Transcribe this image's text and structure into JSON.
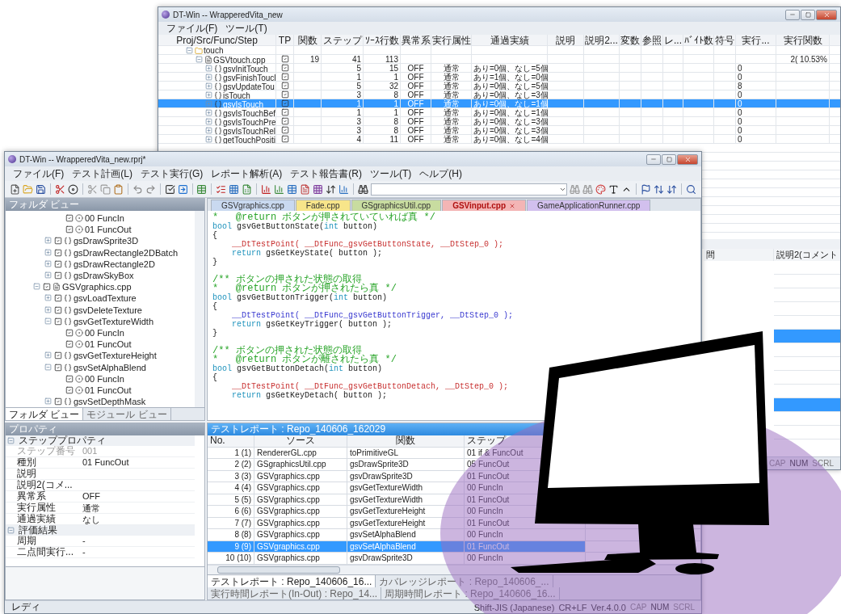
{
  "back_window": {
    "title": "DT-Win -- WrapperedVita_new",
    "menu": [
      "ファイル(F)",
      "ツール(T)"
    ],
    "columns": [
      "Proj/Src/Func/Step",
      "TP",
      "関数",
      "ステップ",
      "ｿｰｽ行数",
      "異常系",
      "実行属性",
      "通過実績",
      "説明",
      "説明2...",
      "変数",
      "参照",
      "レ...",
      "ﾊﾞｲﾄ数",
      "符号",
      "実行...",
      "実行関数"
    ],
    "rows": [
      {
        "label": "touch",
        "kind": "folder",
        "expanded": true,
        "selected": false,
        "children": [
          {
            "label": "GSVtouch.cpp",
            "kind": "file",
            "expanded": true,
            "tp": true,
            "selected": false,
            "cells": [
              "19",
              "41",
              "113",
              null,
              null,
              null,
              null,
              null,
              null,
              null,
              null,
              null,
              null,
              null,
              "2( 10.53%"
            ],
            "children": [
              {
                "label": "gsvInitTouch",
                "kind": "func",
                "expanded": false,
                "tp": true,
                "selected": false,
                "cells": [
                  null,
                  "5",
                  "15",
                  "OFF",
                  "通常",
                  "あり=0個、なし=5個",
                  null,
                  null,
                  null,
                  null,
                  null,
                  null,
                  null,
                  "0",
                  null
                ]
              },
              {
                "label": "gsvFinishToucl",
                "kind": "func",
                "expanded": false,
                "tp": true,
                "selected": false,
                "cells": [
                  null,
                  "1",
                  "1",
                  "OFF",
                  "通常",
                  "あり=1個、なし=0個",
                  null,
                  null,
                  null,
                  null,
                  null,
                  null,
                  null,
                  "0",
                  null
                ]
              },
              {
                "label": "gsvUpdateTou",
                "kind": "func",
                "expanded": false,
                "tp": true,
                "selected": false,
                "cells": [
                  null,
                  "5",
                  "32",
                  "OFF",
                  "通常",
                  "あり=0個、なし=5個",
                  null,
                  null,
                  null,
                  null,
                  null,
                  null,
                  null,
                  "8",
                  null
                ]
              },
              {
                "label": "isTouch",
                "kind": "func",
                "expanded": false,
                "tp": true,
                "selected": false,
                "cells": [
                  null,
                  "3",
                  "8",
                  "OFF",
                  "通常",
                  "あり=0個、なし=3個",
                  null,
                  null,
                  null,
                  null,
                  null,
                  null,
                  null,
                  "0",
                  null
                ]
              },
              {
                "label": "gsvIsTouch",
                "kind": "func",
                "expanded": false,
                "tp": true,
                "selected": true,
                "cells": [
                  null,
                  "1",
                  "1",
                  "OFF",
                  "通常",
                  "あり=0個、なし=1個",
                  null,
                  null,
                  null,
                  null,
                  null,
                  null,
                  null,
                  "0",
                  null
                ]
              },
              {
                "label": "gsvIsTouchBef",
                "kind": "func",
                "expanded": false,
                "tp": true,
                "selected": false,
                "cells": [
                  null,
                  "1",
                  "1",
                  "OFF",
                  "通常",
                  "あり=0個、なし=1個",
                  null,
                  null,
                  null,
                  null,
                  null,
                  null,
                  null,
                  "0",
                  null
                ]
              },
              {
                "label": "gsvIsTouchPre",
                "kind": "func",
                "expanded": false,
                "tp": true,
                "selected": false,
                "cells": [
                  null,
                  "3",
                  "8",
                  "OFF",
                  "通常",
                  "あり=0個、なし=3個",
                  null,
                  null,
                  null,
                  null,
                  null,
                  null,
                  null,
                  "0",
                  null
                ]
              },
              {
                "label": "gsvIsTouchRel",
                "kind": "func",
                "expanded": false,
                "tp": true,
                "selected": false,
                "cells": [
                  null,
                  "3",
                  "8",
                  "OFF",
                  "通常",
                  "あり=0個、なし=3個",
                  null,
                  null,
                  null,
                  null,
                  null,
                  null,
                  null,
                  "0",
                  null
                ]
              },
              {
                "label": "getTouchPositi",
                "kind": "func",
                "expanded": false,
                "tp": true,
                "selected": false,
                "cells": [
                  null,
                  "4",
                  "11",
                  "OFF",
                  "通常",
                  "あり=0個、なし=4個",
                  null,
                  null,
                  null,
                  null,
                  null,
                  null,
                  null,
                  "0",
                  null
                ]
              }
            ]
          }
        ]
      }
    ],
    "lower_columns": [
      "間",
      "説明2(コメント"
    ],
    "lower_rows": [
      {
        "selected": false
      },
      {
        "selected": false
      },
      {
        "selected": false
      },
      {
        "selected": false
      },
      {
        "selected": false
      },
      {
        "selected": true
      },
      {
        "selected": false
      },
      {
        "selected": false
      },
      {
        "selected": false
      },
      {
        "selected": false
      },
      {
        "selected": true
      },
      {
        "selected": false
      },
      {
        "selected": false
      }
    ],
    "indicators": [
      {
        "label": "CAP",
        "on": false
      },
      {
        "label": "NUM",
        "on": true
      },
      {
        "label": "SCRL",
        "on": false
      }
    ]
  },
  "front_window": {
    "title": "DT-Win -- WrapperedVita_new.rprj*",
    "menu": [
      "ファイル(F)",
      "テスト計画(L)",
      "テスト実行(G)",
      "レポート解析(A)",
      "テスト報告書(R)",
      "ツール(T)",
      "ヘルプ(H)"
    ],
    "folder_view": {
      "title": "フォルダ ビュー",
      "tree": [
        {
          "children": [
            {
              "children": [
                {
                  "label": "00 FuncIn",
                  "kind": "step",
                  "checked": true
                },
                {
                  "label": "01 FuncOut",
                  "kind": "step",
                  "checked": true
                }
              ]
            },
            {
              "label": "gsDrawSprite3D",
              "kind": "func",
              "checked": true,
              "expanded": false
            },
            {
              "label": "gsDrawRectangle2DBatch",
              "kind": "func",
              "checked": true,
              "expanded": false
            },
            {
              "label": "gsDrawRectangle2D",
              "kind": "func",
              "checked": true,
              "expanded": false
            },
            {
              "label": "gsDrawSkyBox",
              "kind": "func",
              "checked": true,
              "expanded": false
            }
          ]
        },
        {
          "label": "GSVgraphics.cpp",
          "kind": "file",
          "checked": true,
          "expanded": true,
          "children": [
            {
              "label": "gsvLoadTexture",
              "kind": "func",
              "checked": true,
              "expanded": false
            },
            {
              "label": "gsvDeleteTexture",
              "kind": "func",
              "checked": true,
              "expanded": false
            },
            {
              "label": "gsvGetTextureWidth",
              "kind": "func",
              "checked": true,
              "expanded": true,
              "children": [
                {
                  "label": "00 FuncIn",
                  "kind": "step",
                  "checked": true
                },
                {
                  "label": "01 FuncOut",
                  "kind": "step",
                  "checked": true
                }
              ]
            },
            {
              "label": "gsvGetTextureHeight",
              "kind": "func",
              "checked": true,
              "expanded": false
            },
            {
              "label": "gsvSetAlphaBlend",
              "kind": "func",
              "checked": true,
              "expanded": true,
              "children": [
                {
                  "label": "00 FuncIn",
                  "kind": "step",
                  "checked": true
                },
                {
                  "label": "01 FuncOut",
                  "kind": "step",
                  "checked": true
                }
              ]
            },
            {
              "label": "gsvSetDepthMask",
              "kind": "func",
              "checked": true,
              "expanded": false
            }
          ]
        }
      ],
      "tabs": [
        {
          "label": "フォルダ ビュー",
          "selected": true
        },
        {
          "label": "モジュール ビュー",
          "selected": false
        }
      ]
    },
    "properties": {
      "title": "プロパティ",
      "sections": [
        {
          "label": "ステッププロパティ",
          "expanded": true,
          "rows": [
            {
              "name": "ステップ番号",
              "value": "001",
              "disabled": true
            },
            {
              "name": "種別",
              "value": "01 FuncOut",
              "disabled": false
            },
            {
              "name": "説明",
              "disabled": false
            },
            {
              "name": "説明2(コメ...",
              "disabled": false
            },
            {
              "name": "異常系",
              "value": "OFF",
              "disabled": false
            },
            {
              "name": "実行属性",
              "value": "通常",
              "disabled": false
            },
            {
              "name": "通過実績",
              "value": "なし",
              "disabled": false
            }
          ]
        },
        {
          "label": "評価結果",
          "expanded": true,
          "rows": [
            {
              "name": "周期",
              "value": "-",
              "disabled": false
            },
            {
              "name": "二点間実行...",
              "value": "-",
              "disabled": false
            }
          ]
        }
      ]
    },
    "editor": {
      "tabs": [
        {
          "label": "GSVgraphics.cpp",
          "color": "#c9d9f0",
          "selected": false
        },
        {
          "label": "Fade.cpp",
          "color": "#f7e58a",
          "selected": false
        },
        {
          "label": "GSgraphicsUtil.cpp",
          "color": "#c8dca0",
          "selected": false
        },
        {
          "label": "GSVinput.cpp",
          "color": "#f3b5b5",
          "selected": true
        },
        {
          "label": "GameApplicationRunner.cpp",
          "color": "#d2c0ee",
          "selected": false
        }
      ],
      "lines": [
        [
          {
            "text": "*   @return ボタンが押されていていれば真 */",
            "kind": "comment"
          }
        ],
        [
          {
            "text": "bool",
            "kind": "keyword"
          },
          {
            "text": " gsvGetButtonState(",
            "kind": "plain"
          },
          {
            "text": "int",
            "kind": "keyword"
          },
          {
            "text": " button)",
            "kind": "plain"
          }
        ],
        [
          {
            "text": "{",
            "kind": "plain"
          }
        ],
        [
          {
            "text": "    __DtTestPoint( __DtFunc_gsvGetButtonState, __DtStep_0 );",
            "kind": "probe_hit"
          }
        ],
        [
          {
            "text": "    return",
            "kind": "keyword"
          },
          {
            "text": " gsGetKeyState( button );",
            "kind": "plain"
          }
        ],
        [
          {
            "text": "}",
            "kind": "plain"
          }
        ],
        [
          {
            "text": "/** ボタンの押された状態の取得",
            "kind": "doc_comment"
          }
        ],
        [
          {
            "text": "*   @return ボタンが押されたら真 */",
            "kind": "comment"
          }
        ],
        [
          {
            "text": "bool",
            "kind": "keyword"
          },
          {
            "text": " gsvGetButtonTrigger(",
            "kind": "plain"
          },
          {
            "text": "int",
            "kind": "keyword"
          },
          {
            "text": " button)",
            "kind": "plain"
          }
        ],
        [
          {
            "text": "{",
            "kind": "plain"
          }
        ],
        [
          {
            "text": "    __DtTestPoint( __DtFunc_gsvGetButtonTrigger, __DtStep_0 );",
            "kind": "probe"
          }
        ],
        [
          {
            "text": "    return",
            "kind": "keyword"
          },
          {
            "text": " gsGetKeyTrigger( button );",
            "kind": "plain"
          }
        ],
        [
          {
            "text": "}",
            "kind": "plain"
          }
        ],
        [
          {
            "text": "/** ボタンの押された状態の取得",
            "kind": "doc_comment"
          }
        ],
        [
          {
            "text": "*   @return ボタンが離されたら真 */",
            "kind": "comment"
          }
        ],
        [
          {
            "text": "bool",
            "kind": "keyword"
          },
          {
            "text": " gsvGetButtonDetach(",
            "kind": "plain"
          },
          {
            "text": "int",
            "kind": "keyword"
          },
          {
            "text": " button)",
            "kind": "plain"
          }
        ],
        [
          {
            "text": "{",
            "kind": "plain"
          }
        ],
        [
          {
            "text": "    __DtTestPoint( __DtFunc_gsvGetButtonDetach, __DtStep_0 );",
            "kind": "probe_hit"
          }
        ],
        [
          {
            "text": "    return",
            "kind": "keyword"
          },
          {
            "text": " gsGetKeyDetach( button );",
            "kind": "plain"
          }
        ]
      ]
    },
    "report": {
      "title": "テストレポート : Repo_140606_162029",
      "columns": [
        "No.",
        "ソース",
        "関数",
        "ステップ"
      ],
      "rows": [
        {
          "no": "1 (1)",
          "source": "RendererGL.cpp",
          "function": "toPrimitiveGL",
          "step": "01 if & FuncOut",
          "selected": false
        },
        {
          "no": "2 (2)",
          "source": "GSgraphicsUtil.cpp",
          "function": "gsDrawSprite3D",
          "step": "05 FuncOut",
          "selected": false
        },
        {
          "no": "3 (3)",
          "source": "GSVgraphics.cpp",
          "function": "gsvDrawSprite3D",
          "step": "01 FuncOut",
          "selected": false
        },
        {
          "no": "4 (4)",
          "source": "GSVgraphics.cpp",
          "function": "gsvGetTextureWidth",
          "step": "00 FuncIn",
          "selected": false
        },
        {
          "no": "5 (5)",
          "source": "GSVgraphics.cpp",
          "function": "gsvGetTextureWidth",
          "step": "01 FuncOut",
          "selected": false
        },
        {
          "no": "6 (6)",
          "source": "GSVgraphics.cpp",
          "function": "gsvGetTextureHeight",
          "step": "00 FuncIn",
          "selected": false
        },
        {
          "no": "7 (7)",
          "source": "GSVgraphics.cpp",
          "function": "gsvGetTextureHeight",
          "step": "01 FuncOut",
          "selected": false
        },
        {
          "no": "8 (8)",
          "source": "GSVgraphics.cpp",
          "function": "gsvSetAlphaBlend",
          "step": "00 FuncIn",
          "selected": false
        },
        {
          "no": "9 (9)",
          "source": "GSVgraphics.cpp",
          "function": "gsvSetAlphaBlend",
          "step": "01 FuncOut",
          "selected": true
        },
        {
          "no": "10 (10)",
          "source": "GSVgraphics.cpp",
          "function": "gsvDrawSprite3D",
          "step": "00 FuncIn",
          "selected": false
        }
      ],
      "tabs": [
        {
          "label": "テストレポート : Repo_140606_16...",
          "selected": true
        },
        {
          "label": "カバレッジレポート : Repo_140606_...",
          "selected": false
        },
        {
          "label": "実行時間レポート(In-Out) : Repo_14...",
          "selected": false
        },
        {
          "label": "周期時間レポート : Repo_140606_16...",
          "selected": false
        }
      ]
    },
    "status_bar": {
      "message": "レディ",
      "items": [
        "Shift-JIS (Japanese)",
        "CR+LF",
        "Ver.4.0.0"
      ],
      "indicators": [
        {
          "label": "CAP",
          "on": false
        },
        {
          "label": "NUM",
          "on": true
        },
        {
          "label": "SCRL",
          "on": false
        }
      ]
    }
  }
}
